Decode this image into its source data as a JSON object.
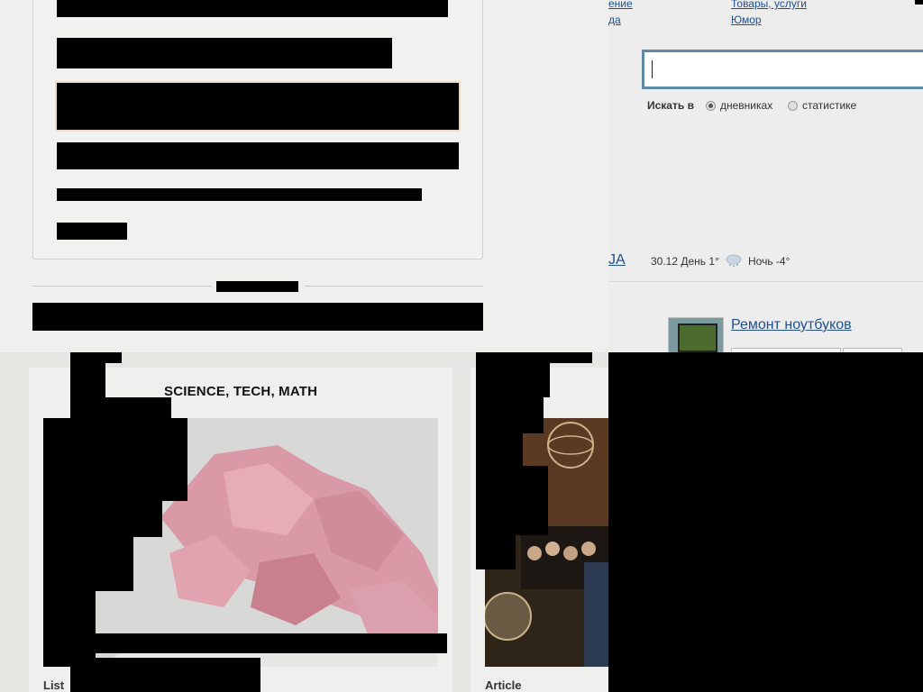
{
  "top_right": {
    "links": [
      "ение",
      "да",
      "Товары, услуги",
      "Юмор"
    ],
    "search": {
      "value": "",
      "label": "Искать в",
      "options": [
        "дневниках",
        "статистике"
      ],
      "selected": "дневниках"
    },
    "weather": {
      "header": "JA",
      "date": "30.12",
      "day": "День 1°",
      "night": "Ночь -4°",
      "icon": "snow-cloud-icon"
    },
    "ad": {
      "title": "Ремонт ноутбуков",
      "icon": "laptop-thumbnail-icon"
    }
  },
  "bottom": {
    "card1": {
      "title": "SCIENCE, TECH, MATH",
      "tag": "List"
    },
    "card2": {
      "tag": "Article"
    }
  },
  "colors": {
    "link": "#1f4f8f",
    "search_border": "#5d8aa8"
  }
}
